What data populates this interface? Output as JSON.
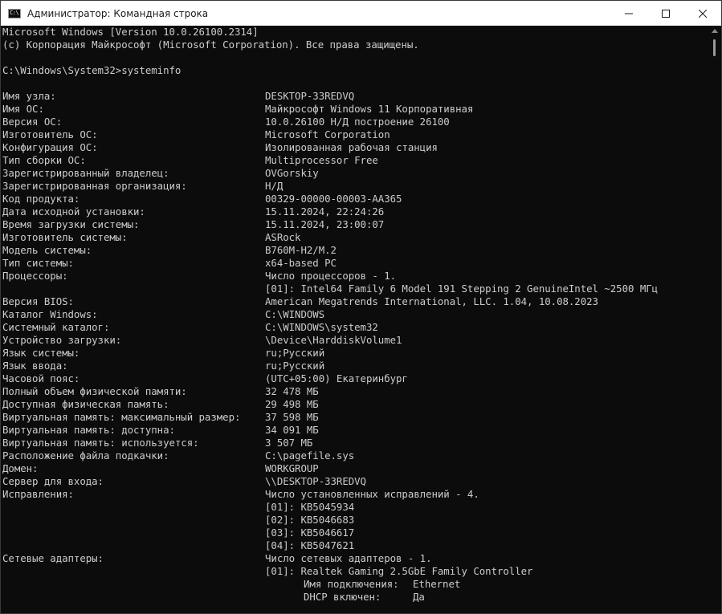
{
  "window": {
    "title": "Администратор: Командная строка",
    "icon_text": "C:\\"
  },
  "console": {
    "header": [
      "Microsoft Windows [Version 10.0.26100.2314]",
      "(c) Корпорация Майкрософт (Microsoft Corporation). Все права защищены."
    ],
    "prompt": "C:\\Windows\\System32>systeminfo",
    "rows": [
      {
        "label": "Имя узла:",
        "value": "DESKTOP-33REDVQ"
      },
      {
        "label": "Имя ОС:",
        "value": "Майкрософт Windows 11 Корпоративная"
      },
      {
        "label": "Версия ОС:",
        "value": "10.0.26100 Н/Д построение 26100"
      },
      {
        "label": "Изготовитель ОС:",
        "value": "Microsoft Corporation"
      },
      {
        "label": "Конфигурация ОС:",
        "value": "Изолированная рабочая станция"
      },
      {
        "label": "Тип сборки ОС:",
        "value": "Multiprocessor Free"
      },
      {
        "label": "Зарегистрированный владелец:",
        "value": "OVGorskiy"
      },
      {
        "label": "Зарегистрированная организация:",
        "value": "Н/Д"
      },
      {
        "label": "Код продукта:",
        "value": "00329-00000-00003-AA365"
      },
      {
        "label": "Дата исходной установки:",
        "value": "15.11.2024, 22:24:26"
      },
      {
        "label": "Время загрузки системы:",
        "value": "15.11.2024, 23:00:07"
      },
      {
        "label": "Изготовитель системы:",
        "value": "ASRock"
      },
      {
        "label": "Модель системы:",
        "value": "B760M-H2/M.2"
      },
      {
        "label": "Тип системы:",
        "value": "x64-based PC"
      },
      {
        "label": "Процессоры:",
        "value": "Число процессоров - 1."
      },
      {
        "label": "",
        "value": "[01]: Intel64 Family 6 Model 191 Stepping 2 GenuineIntel ~2500 МГц"
      },
      {
        "label": "Версия BIOS:",
        "value": "American Megatrends International, LLC. 1.04, 10.08.2023"
      },
      {
        "label": "Каталог Windows:",
        "value": "C:\\WINDOWS"
      },
      {
        "label": "Системный каталог:",
        "value": "C:\\WINDOWS\\system32"
      },
      {
        "label": "Устройство загрузки:",
        "value": "\\Device\\HarddiskVolume1"
      },
      {
        "label": "Язык системы:",
        "value": "ru;Русский"
      },
      {
        "label": "Язык ввода:",
        "value": "ru;Русский"
      },
      {
        "label": "Часовой пояс:",
        "value": "(UTC+05:00) Екатеринбург"
      },
      {
        "label": "Полный объем физической памяти:",
        "value": "32 478 МБ"
      },
      {
        "label": "Доступная физическая память:",
        "value": "29 498 МБ"
      },
      {
        "label": "Виртуальная память: максимальный размер:",
        "value": "37 598 МБ"
      },
      {
        "label": "Виртуальная память: доступна:",
        "value": "34 091 МБ"
      },
      {
        "label": "Виртуальная память: используется:",
        "value": "3 507 МБ"
      },
      {
        "label": "Расположение файла подкачки:",
        "value": "C:\\pagefile.sys"
      },
      {
        "label": "Домен:",
        "value": "WORKGROUP"
      },
      {
        "label": "Сервер для входа:",
        "value": "\\\\DESKTOP-33REDVQ"
      },
      {
        "label": "Исправления:",
        "value": "Число установленных исправлений - 4."
      },
      {
        "label": "",
        "value": "[01]: KB5045934"
      },
      {
        "label": "",
        "value": "[02]: KB5046683"
      },
      {
        "label": "",
        "value": "[03]: KB5046617"
      },
      {
        "label": "",
        "value": "[04]: KB5047621"
      },
      {
        "label": "Сетевые адаптеры:",
        "value": "Число сетевых адаптеров - 1."
      },
      {
        "label": "",
        "value": "[01]: Realtek Gaming 2.5GbE Family Controller"
      }
    ],
    "adapter_details": [
      {
        "label": "Имя подключения:",
        "value": "Ethernet"
      },
      {
        "label": "DHCP включен:",
        "value": "Да"
      }
    ]
  },
  "colors": {
    "background": "#0c0c0c",
    "text": "#cccccc",
    "titlebar": "#ffffff"
  },
  "icons": [
    "cmd-app-icon",
    "minimize-icon",
    "maximize-icon",
    "close-icon",
    "scroll-up-arrow-icon"
  ]
}
